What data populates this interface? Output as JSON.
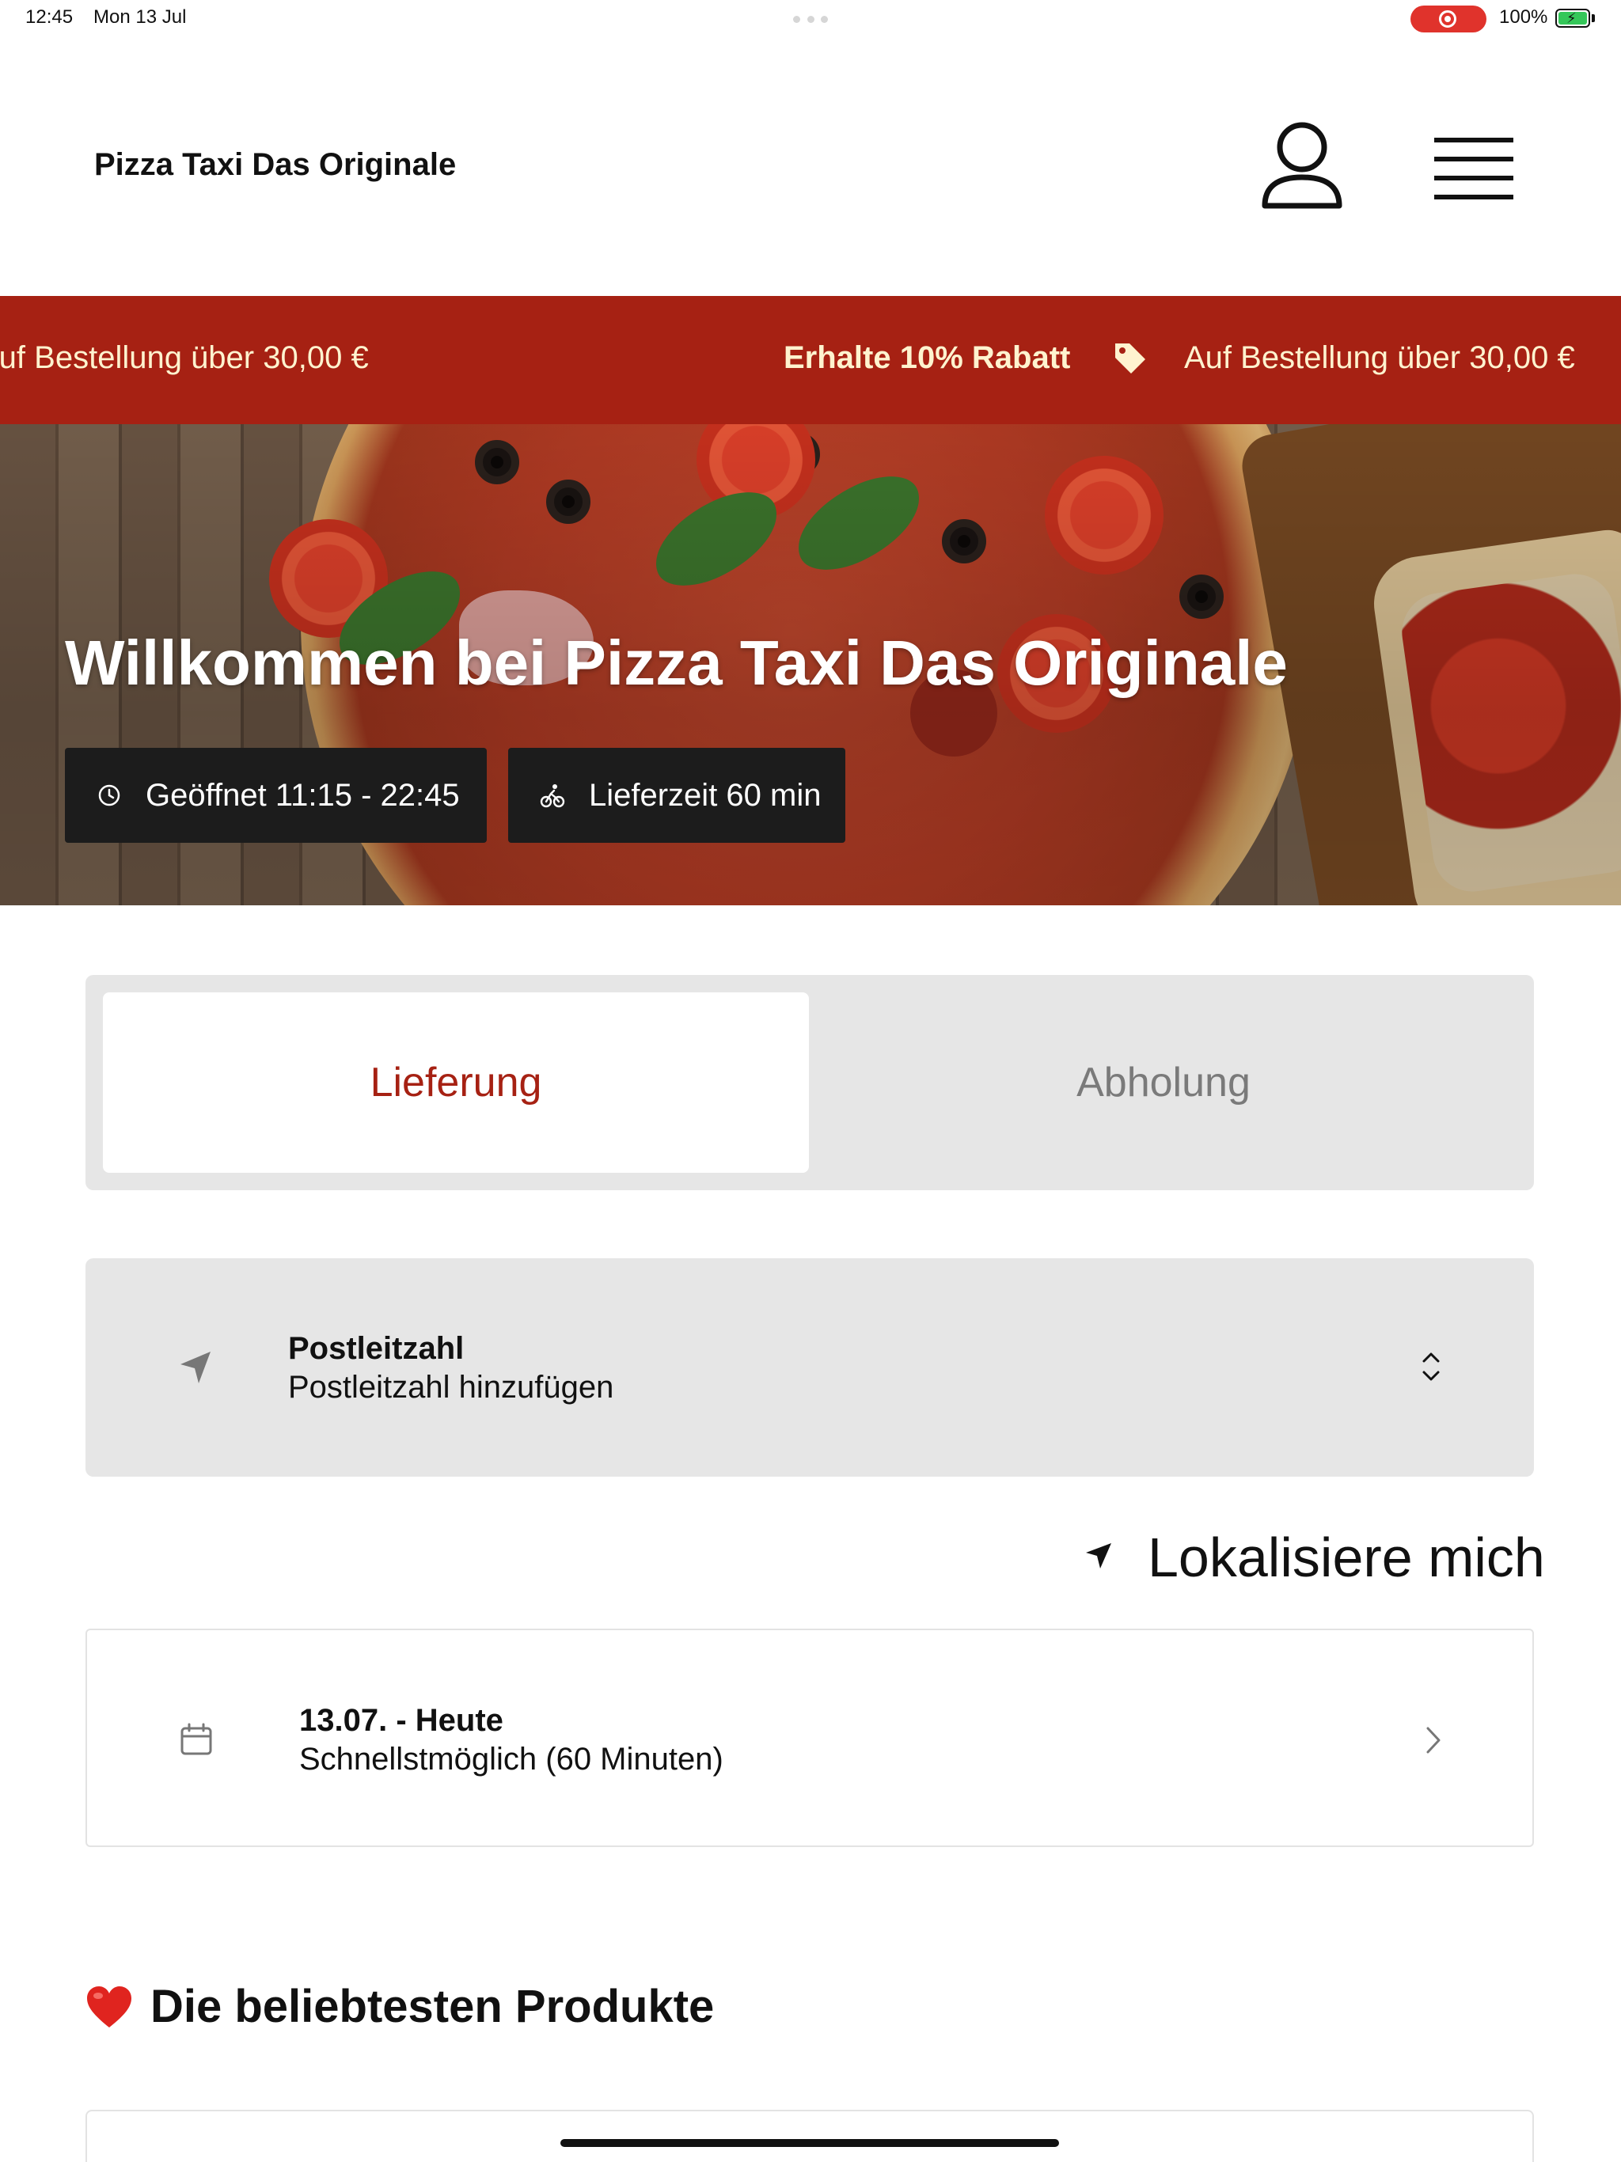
{
  "status_bar": {
    "time": "12:45",
    "date": "Mon 13 Jul",
    "battery": "100%"
  },
  "header": {
    "brand": "Pizza Taxi Das Originale",
    "icons": {
      "account": "user-icon",
      "menu": "hamburger-menu-icon"
    }
  },
  "promo": {
    "text_left": "Auf Bestellung über 30,00 €",
    "text_highlight": "Erhalte 10% Rabatt",
    "text_right": "Auf Bestellung über 30,00 €",
    "background_color": "#a62113",
    "text_color": "#fff3cf"
  },
  "hero": {
    "title": "Willkommen bei Pizza Taxi Das Originale",
    "hours": "Geöffnet 11:15 - 22:45",
    "delivery_time": "Lieferzeit 60 min"
  },
  "order_mode": {
    "options": [
      "Lieferung",
      "Abholung"
    ],
    "selected": "Lieferung",
    "accent_color": "#a62113"
  },
  "postcode": {
    "label": "Postleitzahl",
    "placeholder": "Postleitzahl hinzufügen"
  },
  "locate": {
    "label": "Lokalisiere mich"
  },
  "schedule": {
    "label": "13.07. - Heute",
    "value": "Schnellstmöglich (60 Minuten)"
  },
  "popular": {
    "title": "Die beliebtesten Produkte"
  }
}
